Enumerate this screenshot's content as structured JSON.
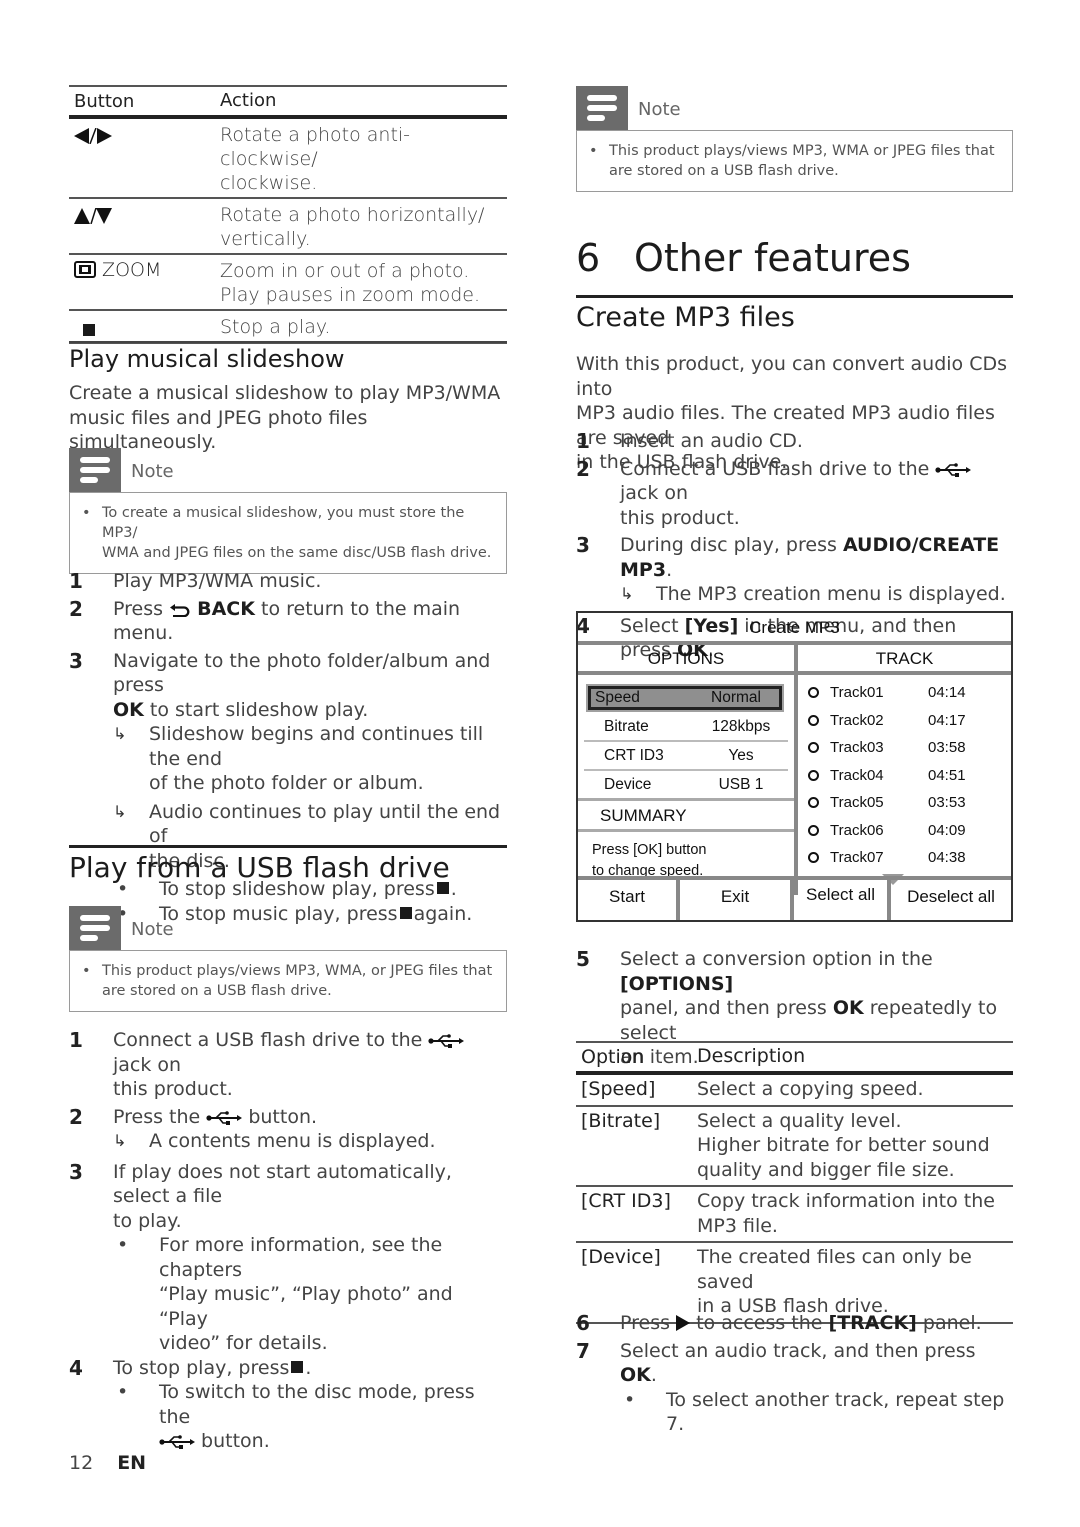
{
  "button_table": {
    "headers": [
      "Button",
      "Action"
    ],
    "rows": [
      {
        "icon": "left-right-arrows-icon",
        "button": "",
        "action_lines": [
          "Rotate a photo anti-clockwise/",
          "clockwise."
        ]
      },
      {
        "icon": "up-down-arrows-icon",
        "button": "",
        "action_lines": [
          "Rotate a photo horizontally/",
          "vertically."
        ]
      },
      {
        "icon": "zoom-icon",
        "button": "ZOOM",
        "action_lines": [
          "Zoom in or out of a photo.",
          "Play pauses in zoom mode."
        ]
      },
      {
        "icon": "stop-icon",
        "button": "",
        "action_lines": [
          "Stop a play."
        ]
      }
    ]
  },
  "slideshow": {
    "heading": "Play musical slideshow",
    "intro_lines": [
      "Create a musical slideshow to play MP3/WMA",
      "music files and JPEG photo files simultaneously."
    ],
    "note": {
      "label": "Note",
      "lines": [
        "To create a musical slideshow, you must store the MP3/",
        "WMA and JPEG files on the same disc/USB flash drive."
      ]
    },
    "steps": [
      {
        "num": "1",
        "text": "Play MP3/WMA music."
      },
      {
        "num": "2",
        "pre": "Press",
        "bold": "BACK",
        "post": "to return to the main menu."
      },
      {
        "num": "3",
        "line1": "Navigate to the photo folder/album and press",
        "bold": "OK",
        "post": "to start slideshow play."
      }
    ],
    "results": [
      {
        "lines": [
          "Slideshow begins and continues till the end",
          "of the photo folder or album."
        ]
      },
      {
        "lines": [
          "Audio continues to play until the end of",
          "the disc."
        ]
      }
    ],
    "bullets": [
      {
        "pre": "To stop slideshow play, press",
        "post": "."
      },
      {
        "pre": "To stop music play, press",
        "post": "again."
      }
    ]
  },
  "usb": {
    "heading": "Play from a USB flash drive",
    "note": {
      "label": "Note",
      "lines": [
        "This product plays/views MP3, WMA, or JPEG files that",
        "are stored on a USB flash drive."
      ]
    },
    "steps": {
      "s1": {
        "num": "1",
        "pre": "Connect a USB flash drive to the",
        "post": "jack on",
        "line2": "this product."
      },
      "s2": {
        "num": "2",
        "pre": "Press the",
        "post": "button.",
        "result": "A contents menu is displayed."
      },
      "s3": {
        "num": "3",
        "lines": [
          "If play does not start automatically, select a file",
          "to play."
        ],
        "bullet_lines": [
          "For more information, see the chapters",
          "“Play music”, “Play photo” and “Play",
          "video” for details."
        ]
      },
      "s4": {
        "num": "4",
        "pre": "To stop play, press",
        "post": ".",
        "bullet_line1": "To switch to the disc mode, press the",
        "bullet_line2": "button."
      }
    }
  },
  "right_note": {
    "label": "Note",
    "lines": [
      "This product plays/views MP3, WMA or JPEG files that",
      "are stored on a USB flash drive."
    ]
  },
  "chapter": {
    "number": "6",
    "title": "Other features"
  },
  "create_mp3": {
    "heading": "Create MP3 files",
    "intro_lines": [
      "With this product, you can convert audio CDs into",
      "MP3 audio files. The created MP3 audio files are saved",
      "in the USB flash drive."
    ],
    "steps": {
      "s1": {
        "num": "1",
        "text": "Insert an audio CD."
      },
      "s2": {
        "num": "2",
        "pre": "Connect a USB flash drive to the",
        "post": "jack on",
        "line2": "this product."
      },
      "s3": {
        "num": "3",
        "pre": "During disc play, press",
        "bold": "AUDIO/CREATE MP3",
        "post": ".",
        "result": "The MP3 creation menu is displayed."
      },
      "s4": {
        "num": "4",
        "pre": "Select",
        "bold1": "[Yes]",
        "mid": "in the menu, and then press",
        "bold2": "OK",
        "post": "."
      },
      "s5": {
        "num": "5",
        "pre": "Select a conversion option in the",
        "bold1": "[OPTIONS]",
        "line2_pre": "panel, and then press",
        "bold2": "OK",
        "line2_post": "repeatedly to select",
        "line3": "an item."
      },
      "s6": {
        "num": "6",
        "pre": "Press",
        "mid": "to access the",
        "bold": "[TRACK]",
        "post": "panel."
      },
      "s7": {
        "num": "7",
        "pre": "Select an audio track, and then press",
        "bold": "OK",
        "post": ".",
        "bullet": "To select another track, repeat step 7."
      }
    }
  },
  "mp3_screen": {
    "title": "Create MP3",
    "options_header": "OPTIONS",
    "track_header": "TRACK",
    "options": [
      {
        "key": "Speed",
        "value": "Normal",
        "selected": true
      },
      {
        "key": "Bitrate",
        "value": "128kbps"
      },
      {
        "key": "CRT ID3",
        "value": "Yes"
      },
      {
        "key": "Device",
        "value": "USB 1"
      }
    ],
    "summary_label": "SUMMARY",
    "summary_lines": [
      "Press [OK] button",
      "to change speed."
    ],
    "tracks": [
      {
        "name": "Track01",
        "duration": "04:14"
      },
      {
        "name": "Track02",
        "duration": "04:17"
      },
      {
        "name": "Track03",
        "duration": "03:58"
      },
      {
        "name": "Track04",
        "duration": "04:51"
      },
      {
        "name": "Track05",
        "duration": "03:53"
      },
      {
        "name": "Track06",
        "duration": "04:09"
      },
      {
        "name": "Track07",
        "duration": "04:38"
      }
    ],
    "buttons": [
      "Start",
      "Exit",
      "Select all",
      "Deselect all"
    ]
  },
  "option_table": {
    "headers": [
      "Option",
      "Description"
    ],
    "rows": [
      {
        "option": "[Speed]",
        "lines": [
          "Select a copying speed."
        ]
      },
      {
        "option": "[Bitrate]",
        "lines": [
          "Select a quality level.",
          "Higher bitrate for better sound",
          "quality and bigger file size."
        ]
      },
      {
        "option": "[CRT ID3]",
        "lines": [
          "Copy track information into the",
          "MP3 file."
        ]
      },
      {
        "option": "[Device]",
        "lines": [
          "The created files can only be saved",
          "in a USB flash drive."
        ]
      }
    ]
  },
  "footer": {
    "page": "12",
    "lang": "EN"
  }
}
